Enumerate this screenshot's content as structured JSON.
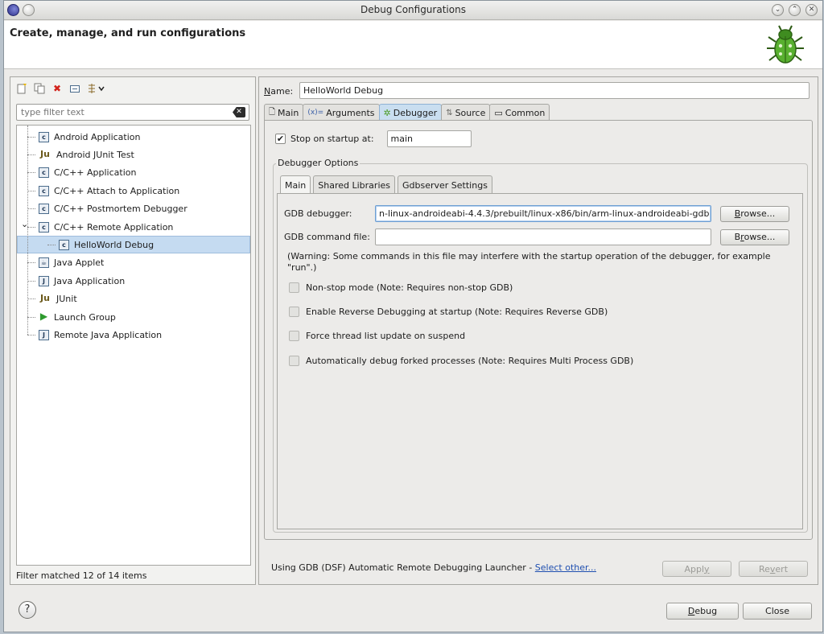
{
  "window": {
    "title": "Debug Configurations"
  },
  "header": {
    "title": "Create, manage, and run configurations",
    "icon": "bug-icon"
  },
  "left": {
    "filter_placeholder": "type filter text",
    "tree": [
      {
        "label": "Android Application",
        "icon": "android-app-icon",
        "level": 0
      },
      {
        "label": "Android JUnit Test",
        "icon": "junit-icon",
        "level": 0
      },
      {
        "label": "C/C++ Application",
        "icon": "c-icon",
        "level": 0
      },
      {
        "label": "C/C++ Attach to Application",
        "icon": "c-icon",
        "level": 0
      },
      {
        "label": "C/C++ Postmortem Debugger",
        "icon": "c-icon",
        "level": 0
      },
      {
        "label": "C/C++ Remote Application",
        "icon": "c-icon",
        "level": 0,
        "expanded": true
      },
      {
        "label": "HelloWorld Debug",
        "icon": "c-icon",
        "level": 1,
        "selected": true
      },
      {
        "label": "Java Applet",
        "icon": "applet-icon",
        "level": 0
      },
      {
        "label": "Java Application",
        "icon": "java-app-icon",
        "level": 0
      },
      {
        "label": "JUnit",
        "icon": "junit-icon",
        "level": 0
      },
      {
        "label": "Launch Group",
        "icon": "launch-group-icon",
        "level": 0
      },
      {
        "label": "Remote Java Application",
        "icon": "remote-java-icon",
        "level": 0
      }
    ],
    "status": "Filter matched 12 of 14 items"
  },
  "right": {
    "name_label": "Name:",
    "name_value": "HelloWorld Debug",
    "tabs": [
      {
        "label": "Main",
        "icon": "main-tab-icon"
      },
      {
        "label": "Arguments",
        "icon": "arguments-icon"
      },
      {
        "label": "Debugger",
        "icon": "debugger-icon",
        "active": true
      },
      {
        "label": "Source",
        "icon": "source-icon"
      },
      {
        "label": "Common",
        "icon": "common-icon"
      }
    ],
    "stop_label": "Stop on startup at:",
    "stop_value": "main",
    "stop_checked": true,
    "group_title": "Debugger Options",
    "inner_tabs": [
      {
        "label": "Main",
        "active": true
      },
      {
        "label": "Shared Libraries"
      },
      {
        "label": "Gdbserver Settings"
      }
    ],
    "gdb_label": "GDB debugger:",
    "gdb_value": "n-linux-androideabi-4.4.3/prebuilt/linux-x86/bin/arm-linux-androideabi-gdb",
    "gdb_cmd_label": "GDB command file:",
    "gdb_cmd_value": "",
    "browse_label": "Browse...",
    "warning": "(Warning: Some commands in this file may interfere with the startup operation of the debugger, for example \"run\".)",
    "options": [
      "Non-stop mode (Note: Requires non-stop GDB)",
      "Enable Reverse Debugging at startup (Note: Requires Reverse GDB)",
      "Force thread list update on suspend",
      "Automatically debug forked processes (Note: Requires Multi Process GDB)"
    ],
    "launcher_text": "Using GDB (DSF) Automatic Remote Debugging Launcher - ",
    "select_other": "Select other...",
    "apply": "Apply",
    "revert": "Revert"
  },
  "footer": {
    "help": "?",
    "debug": "Debug",
    "close": "Close"
  }
}
